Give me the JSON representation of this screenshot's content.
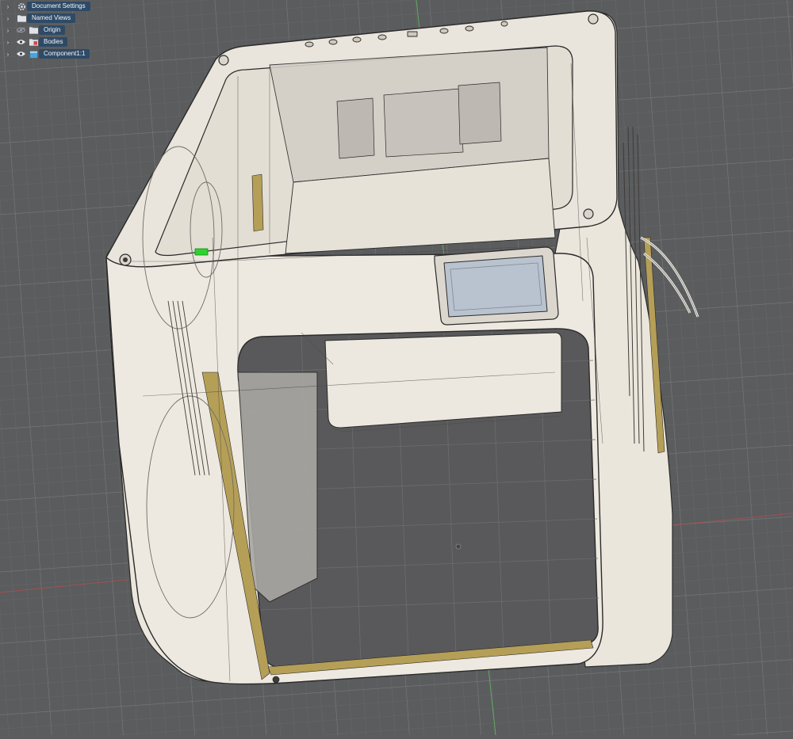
{
  "browser": {
    "items": [
      {
        "label": "Document Settings",
        "icon": "gear-icon",
        "visible_toggle": false
      },
      {
        "label": "Named Views",
        "icon": "folder-icon",
        "visible_toggle": false
      },
      {
        "label": "Origin",
        "icon": "folder-icon",
        "visible_toggle": true,
        "hidden": true
      },
      {
        "label": "Bodies",
        "icon": "bodies-folder-icon",
        "visible_toggle": true,
        "hidden": false
      },
      {
        "label": "Component1:1",
        "icon": "component-icon",
        "visible_toggle": true,
        "hidden": false
      }
    ]
  },
  "model": {
    "touchscreen_color": "#b9c3cf",
    "body_color": "#efebe3",
    "accent_color": "#b59f57",
    "highlight_color": "#2fd12f"
  },
  "colors": {
    "grid_background": "#5b5c5e",
    "grid_line": "#6c6d70",
    "axis_red": "#b05050",
    "axis_green": "#5fbf5f"
  }
}
